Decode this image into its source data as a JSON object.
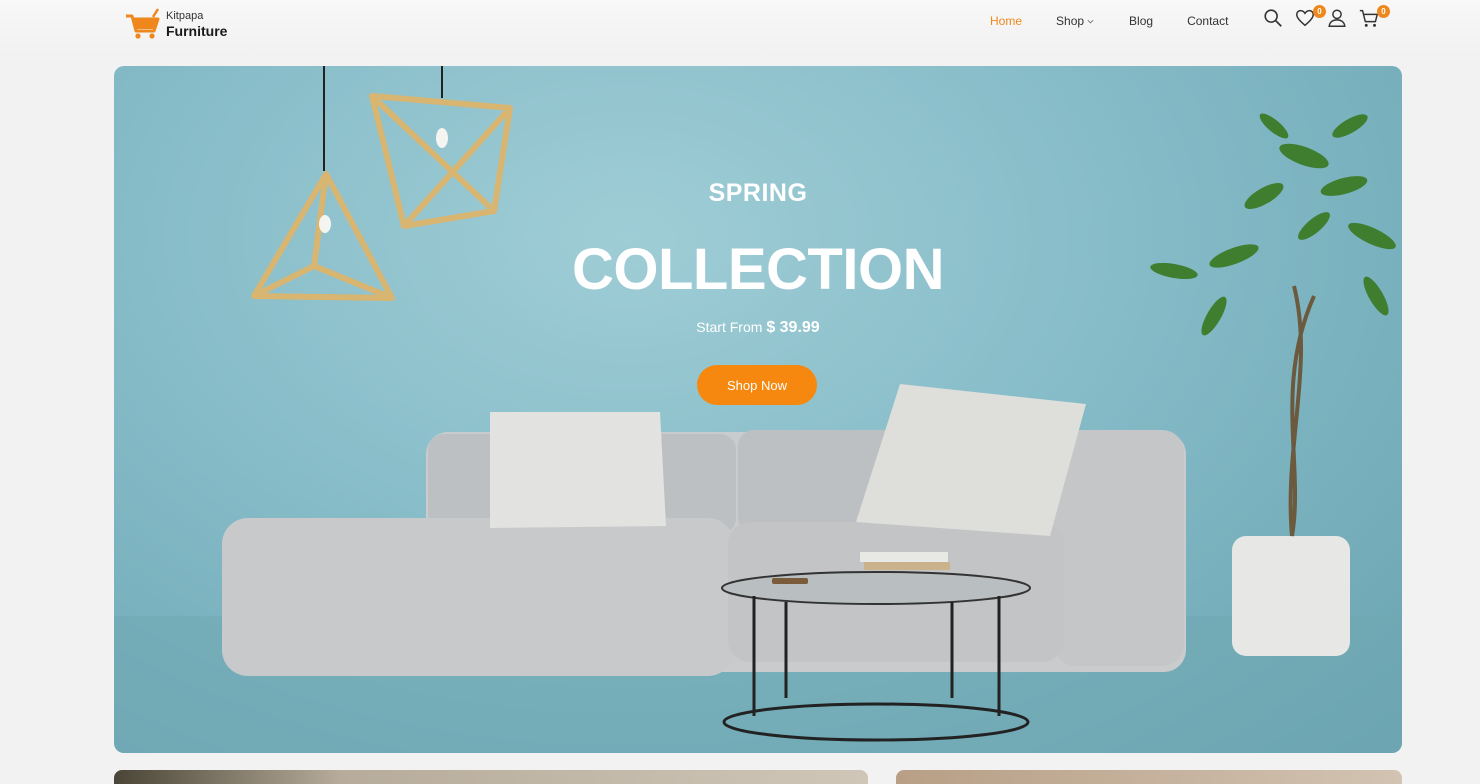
{
  "brand": {
    "small": "Kitpapa",
    "name": "Furniture",
    "accent_color": "#f0871c",
    "logo_icon": "shopping-cart-icon"
  },
  "nav": {
    "items": [
      {
        "label": "Home",
        "active": true
      },
      {
        "label": "Shop",
        "has_dropdown": true
      },
      {
        "label": "Blog"
      },
      {
        "label": "Contact"
      }
    ]
  },
  "header_icons": {
    "search": "search-icon",
    "wishlist": {
      "icon": "heart-icon",
      "count": "0"
    },
    "account": "user-icon",
    "cart": {
      "icon": "cart-icon",
      "count": "0"
    }
  },
  "hero": {
    "eyebrow": "SPRING",
    "title": "COLLECTION",
    "price_prefix": "Start From",
    "price": "$ 39.99",
    "button_label": "Shop Now",
    "button_color": "#f7880f",
    "background_color": "#86bcc8"
  }
}
